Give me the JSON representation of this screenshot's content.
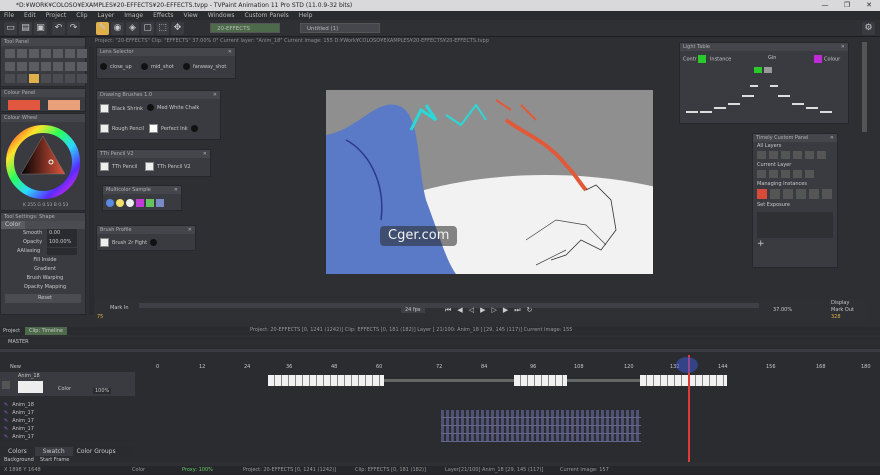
{
  "window": {
    "title": "*D:¥WORK¥COLOSO¥EXAMPLES¥20-EFFECTS¥20-EFFECTS.tvpp - TVPaint Animation 11 Pro STD (11.0.9-32 bits)",
    "min": "—",
    "max": "❐",
    "close": "✕"
  },
  "menu": [
    "File",
    "Edit",
    "Project",
    "Clip",
    "Layer",
    "Image",
    "Effects",
    "View",
    "Windows",
    "Custom Panels",
    "Help"
  ],
  "toolbar": {
    "tab1": "20-EFFECTS",
    "tab2": "Untitled (1)"
  },
  "infobar": "Project: \"20-EFFECTS\"  Clip: \"EFFECTS\"  37.00%  0°  Current layer: \"Anim_18\"  Current image: 155  D:¥Work¥COLOSO¥EXAMPLES¥20-EFFECTS¥20-EFFECTS.tvpp",
  "tool_panel": {
    "title": "Tool Panel"
  },
  "color_panel": {
    "title": "Colour Panel"
  },
  "color_wheel": {
    "title": "Colour Wheel",
    "readout": "K 255 G 0.53 B 0.53"
  },
  "tool_settings": {
    "title": "Tool Settings: Shape",
    "tabs": [
      "Color",
      "",
      ""
    ],
    "smooth_label": "Smooth",
    "smooth_value": "0.00",
    "opacity_label": "Opacity",
    "opacity_value": "100.00%",
    "aa_label": "AAliasing",
    "items": [
      "Fill Inside",
      "Gradient",
      "Brush Warping",
      "Opacity Mapping"
    ],
    "reset": "Reset"
  },
  "lens_panel": {
    "title": "Lens Selector",
    "items": [
      "close_up",
      "mid_shot",
      "faraway_shot"
    ]
  },
  "sketch_panel": {
    "title": "Drawing Brushes 1.0",
    "items": [
      "Black Shrink",
      "Med White Chalk",
      "Rough Pencil",
      "Perfect Ink"
    ]
  },
  "tth_panel": {
    "title": "TTh Pencil V2",
    "items": [
      "TTh Pencil",
      "TTh Pencil V2"
    ]
  },
  "palette_panel": {
    "title": "Multicolor Sample"
  },
  "brush_panel": {
    "title": "Brush Profile",
    "items": [
      "Brush 2r Fight"
    ]
  },
  "light_table": {
    "title": "Light Table",
    "left_label": "Contr",
    "instance_label": "Instance",
    "onion_label": "Gin",
    "right_label": "Colour"
  },
  "timeline_control": {
    "title": "Timely Custom Panel",
    "items": [
      "All Layers",
      "Current Layer",
      "Managing Instances",
      "Set Exposure"
    ]
  },
  "playback": {
    "mark_in": "Mark In",
    "mark_in_value": "75",
    "fps": "24 fps",
    "zoom": "37.00%",
    "display": "Display",
    "mark_out": "Mark Out",
    "mark_out_value": "328"
  },
  "watermark": {
    "text": "Cger.com"
  },
  "timeline": {
    "tabs": [
      "Project",
      "Clip: Timeline"
    ],
    "clip_info": "Project: 20-EFFECTS [0, 1241 (1242)]    Clip: EFFECTS [0, 181 (182)]    Layer [ 21/100: Anim_18 ] [29, 145 (117)]    Current Image: 155",
    "master_label": "MASTER",
    "new_label": "New",
    "layer_label": "Anim_18",
    "opacity": "100%",
    "blend": "Color",
    "ruler": [
      "0",
      "12",
      "24",
      "36",
      "48",
      "60",
      "72",
      "84",
      "96",
      "108",
      "120",
      "132",
      "144",
      "156",
      "168",
      "180"
    ],
    "layers": [
      "Anim_18",
      "Anim_17",
      "Anim_17",
      "Anim_17",
      "Anim_17"
    ]
  },
  "bottom_tabs": [
    "Colors",
    "Swatch",
    "Color Groups"
  ],
  "statusbar": {
    "left": "X 1898  Y 1648",
    "color": "Color",
    "zoom": "Proxy: 100%",
    "project": "Project: 20-EFFECTS [0, 1241 (1242)]",
    "clip": "Clip: EFFECTS [0, 181 (182)]",
    "layer": "Layer[21/100] Anim_18 [29, 145 (117)]",
    "image": "Current image: 157",
    "bg": "Background",
    "start": "Start Frame"
  }
}
